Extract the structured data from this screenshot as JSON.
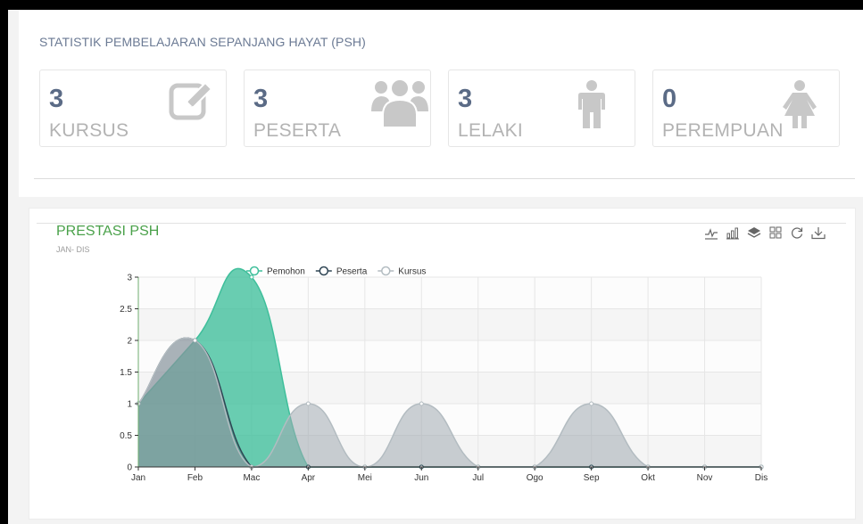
{
  "header": {
    "title": "STATISTIK PEMBELAJARAN SEPANJANG HAYAT (PSH)"
  },
  "stats": [
    {
      "value": "3",
      "label": "KURSUS",
      "icon": "edit-icon"
    },
    {
      "value": "3",
      "label": "PESERTA",
      "icon": "users-icon"
    },
    {
      "value": "3",
      "label": "LELAKI",
      "icon": "male-icon"
    },
    {
      "value": "0",
      "label": "PEREMPUAN",
      "icon": "female-icon"
    }
  ],
  "toolbox": [
    "line-chart-icon",
    "bar-chart-icon",
    "stack-icon",
    "tiled-icon",
    "restore-icon",
    "download-icon"
  ],
  "colors": {
    "pemohon": "#3fbf9b",
    "peserta": "#2f4554",
    "kursus": "#b3bcc1",
    "title": "#4aa14a",
    "stat_value": "#5b6b86"
  },
  "chart_data": {
    "type": "area",
    "title": "PRESTASI PSH",
    "subtitle": "JAN- DIS",
    "categories": [
      "Jan",
      "Feb",
      "Mac",
      "Apr",
      "Mei",
      "Jun",
      "Jul",
      "Ogo",
      "Sep",
      "Okt",
      "Nov",
      "Dis"
    ],
    "series": [
      {
        "name": "Pemohon",
        "values": [
          1,
          2,
          3,
          0,
          0,
          0,
          0,
          0,
          0,
          0,
          0,
          0
        ]
      },
      {
        "name": "Peserta",
        "values": [
          1,
          2,
          0,
          0,
          0,
          0,
          0,
          0,
          0,
          0,
          0,
          0
        ]
      },
      {
        "name": "Kursus",
        "values": [
          1,
          2,
          0,
          1,
          0,
          1,
          0,
          0,
          1,
          0,
          0,
          0
        ]
      }
    ],
    "y_ticks": [
      "0",
      "0.5",
      "1",
      "1.5",
      "2",
      "2.5",
      "3"
    ],
    "ylim": [
      0,
      3
    ],
    "smooth": true,
    "legend_position": "top-center",
    "grid": true
  }
}
